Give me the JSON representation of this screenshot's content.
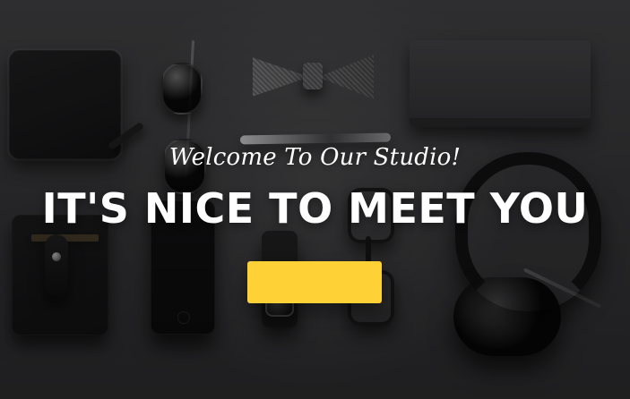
{
  "hero": {
    "subtitle": "Welcome To Our Studio!",
    "headline": "IT'S NICE TO MEET YOU",
    "cta_label": ""
  },
  "colors": {
    "accent": "#fed136",
    "text": "#ffffff"
  },
  "icons": {
    "decorative_objects": [
      "wallet",
      "sunglasses",
      "bowtie",
      "pen",
      "notebook",
      "cardholder",
      "phone",
      "watch",
      "eyeglasses",
      "headphones"
    ]
  }
}
